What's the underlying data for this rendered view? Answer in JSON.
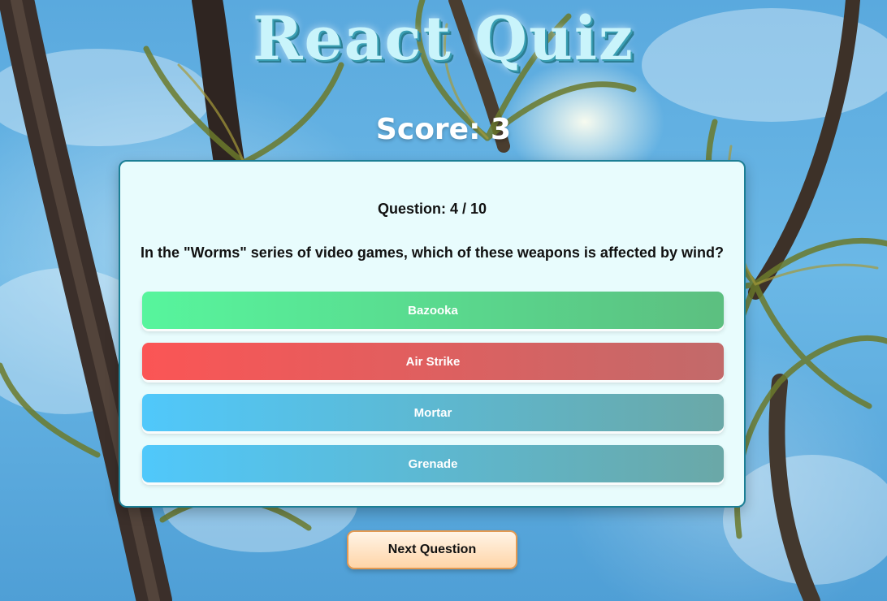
{
  "app": {
    "title": "React Quiz"
  },
  "score": {
    "text": "Score: 3"
  },
  "question": {
    "counter": "Question: 4 / 10",
    "text": "In the \"Worms\" series of video games, which of these weapons is affected by wind?"
  },
  "answers": [
    {
      "label": "Bazooka",
      "state": "correct"
    },
    {
      "label": "Air Strike",
      "state": "wrong"
    },
    {
      "label": "Mortar",
      "state": "neutral"
    },
    {
      "label": "Grenade",
      "state": "neutral"
    }
  ],
  "controls": {
    "next_label": "Next Question"
  },
  "colors": {
    "correct": "#57f59d",
    "wrong": "#fb5555",
    "neutral": "#50c8fb",
    "card_background": "#e8fcfd",
    "card_border": "#1c7f95",
    "title": "#c9f4fb",
    "next_button": "#ffd5a8"
  },
  "background": {
    "icon": "palm-trees-sky-photo"
  }
}
